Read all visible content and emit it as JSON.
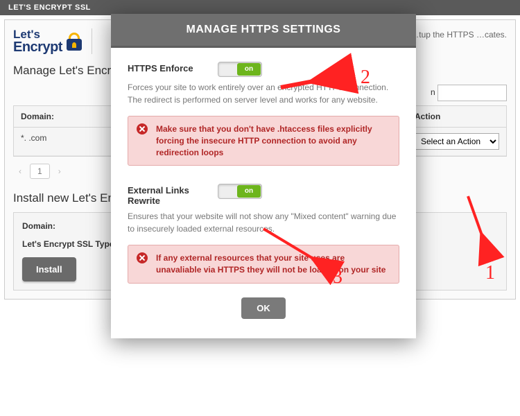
{
  "titlebar": "LET'S ENCRYPT SSL",
  "logo": {
    "line1": "Let's",
    "line2": "Encrypt"
  },
  "intro_text": "can easily manage …tup the HTTPS …cates.",
  "manage_heading": "Manage Let's Encry",
  "domain_filter": {
    "label": "n",
    "value": ""
  },
  "table": {
    "headers": {
      "domain": "Domain:",
      "action": "Action"
    },
    "rows": [
      {
        "domain_display": "*.                         .com",
        "subdomain_blur": "                         "
      }
    ],
    "action_placeholder": "Select an Action"
  },
  "pager": {
    "prev": "‹",
    "page": "1",
    "next": "›"
  },
  "install": {
    "heading": "Install new Let's Enc",
    "domain_label": "Domain:",
    "type_label": "Let's Encrypt SSL Type:",
    "button": "Install"
  },
  "modal": {
    "title": "MANAGE HTTPS SETTINGS",
    "enforce": {
      "label": "HTTPS Enforce",
      "toggle": "on",
      "desc": "Forces your site to work entirely over an encrypted HTTPS connection. The redirect is performed on server level and works for any website.",
      "warn": "Make sure that you don't have .htaccess files explicitly forcing the insecure HTTP connection to avoid any redirection loops"
    },
    "rewrite": {
      "label": "External Links Rewrite",
      "toggle": "on",
      "desc": "Ensures that your website will not show any \"Mixed content\" warning due to insecurely loaded external resources.",
      "warn": "If any external resources that your site uses are unavaliable via HTTPS they will not be loaded on your site"
    },
    "ok": "OK"
  },
  "annotations": {
    "n1": "1",
    "n2": "2",
    "n3": "3"
  }
}
